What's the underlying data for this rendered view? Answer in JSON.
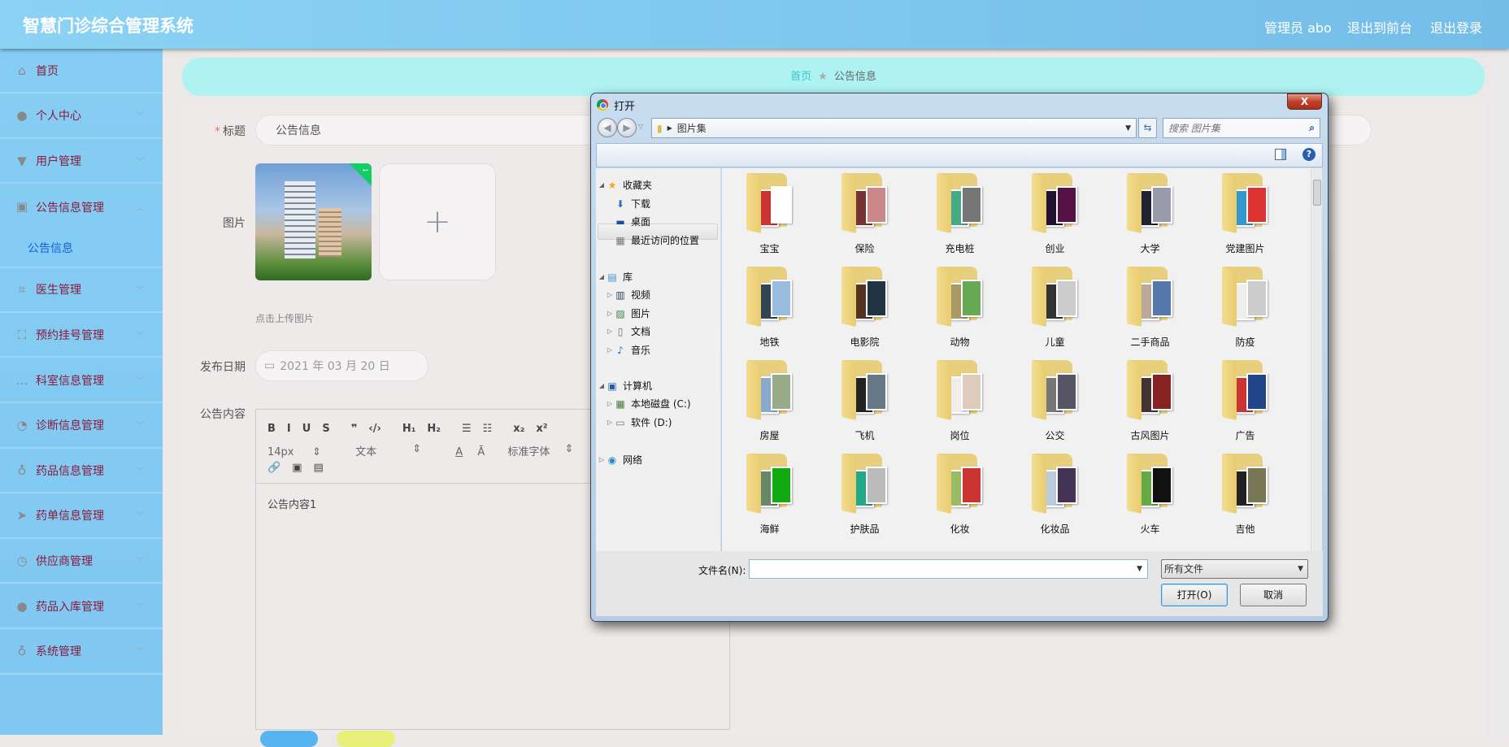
{
  "header": {
    "title": "智慧门诊综合管理系统",
    "user": "管理员 abo",
    "front": "退出到前台",
    "logout": "退出登录"
  },
  "sidebar": {
    "items": [
      {
        "label": "首页",
        "icon": "home-icon",
        "glyph": "⌂"
      },
      {
        "label": "个人中心",
        "icon": "user-icon",
        "glyph": "●"
      },
      {
        "label": "用户管理",
        "icon": "pin-icon",
        "glyph": "▼"
      },
      {
        "label": "公告信息管理",
        "icon": "clipboard-icon",
        "glyph": "▣",
        "expanded": true,
        "sub": "公告信息"
      },
      {
        "label": "医生管理",
        "icon": "crop-icon",
        "glyph": "⌗"
      },
      {
        "label": "预约挂号管理",
        "icon": "fullscreen-icon",
        "glyph": "⛶"
      },
      {
        "label": "科室信息管理",
        "icon": "chat-icon",
        "glyph": "…"
      },
      {
        "label": "诊断信息管理",
        "icon": "dashboard-icon",
        "glyph": "◔"
      },
      {
        "label": "药品信息管理",
        "icon": "microphone-icon",
        "glyph": "♁"
      },
      {
        "label": "药单信息管理",
        "icon": "send-icon",
        "glyph": "➤"
      },
      {
        "label": "供应商管理",
        "icon": "clock-icon",
        "glyph": "◷"
      },
      {
        "label": "药品入库管理",
        "icon": "user-icon",
        "glyph": "●"
      },
      {
        "label": "系统管理",
        "icon": "mic-icon",
        "glyph": "♁"
      }
    ]
  },
  "breadcrumb": {
    "home": "首页",
    "sep": "★",
    "current": "公告信息"
  },
  "form": {
    "title_label": "标题",
    "title_value": "公告信息",
    "image_label": "图片",
    "upload_tip": "点击上传图片",
    "date_label": "发布日期",
    "date_value": "2021 年 03 月 20 日",
    "content_label": "公告内容",
    "content_value": "公告内容1"
  },
  "editor": {
    "row1": [
      "B",
      "I",
      "U",
      "S",
      "❞",
      "‹/›",
      "H₁",
      "H₂",
      "☰",
      "☷",
      "x₂",
      "x²"
    ],
    "size": "14px",
    "type": "文本",
    "font": "标准字体",
    "row3": [
      "🔗",
      "▣",
      "▤"
    ]
  },
  "dialog": {
    "title": "打开",
    "close": "X",
    "path": "图片集",
    "search_placeholder": "搜索 图片集",
    "nav": [
      {
        "label": "收藏夹",
        "icon": "star-icon",
        "glyph": "★",
        "color": "#f2a516",
        "level": 0,
        "tri": "◢"
      },
      {
        "label": "下载",
        "icon": "download-icon",
        "glyph": "⬇",
        "color": "#2a6fc9",
        "level": 1
      },
      {
        "label": "桌面",
        "icon": "desktop-icon",
        "glyph": "▬",
        "color": "#1d4f9e",
        "level": 1
      },
      {
        "label": "最近访问的位置",
        "icon": "recent-icon",
        "glyph": "▦",
        "color": "#777",
        "level": 1
      },
      {
        "label": "库",
        "icon": "library-icon",
        "glyph": "▤",
        "color": "#3b8fd0",
        "level": 0,
        "tri": "◢"
      },
      {
        "label": "视频",
        "icon": "video-icon",
        "glyph": "▥",
        "color": "#345",
        "level": 1,
        "tri": "▷"
      },
      {
        "label": "图片",
        "icon": "picture-icon",
        "glyph": "▨",
        "color": "#3a7d4e",
        "level": 1,
        "tri": "▷"
      },
      {
        "label": "文档",
        "icon": "document-icon",
        "glyph": "▯",
        "color": "#667",
        "level": 1,
        "tri": "▷"
      },
      {
        "label": "音乐",
        "icon": "music-icon",
        "glyph": "♪",
        "color": "#1b6fd0",
        "level": 1,
        "tri": "▷"
      },
      {
        "label": "计算机",
        "icon": "computer-icon",
        "glyph": "▣",
        "color": "#1d5fae",
        "level": 0,
        "tri": "◢"
      },
      {
        "label": "本地磁盘 (C:)",
        "icon": "drive-c-icon",
        "glyph": "▦",
        "color": "#4a7a3a",
        "level": 1,
        "tri": "▷"
      },
      {
        "label": "软件 (D:)",
        "icon": "drive-d-icon",
        "glyph": "▭",
        "color": "#777",
        "level": 1,
        "tri": "▷"
      },
      {
        "label": "网络",
        "icon": "network-icon",
        "glyph": "◉",
        "color": "#2a88c9",
        "level": 0,
        "tri": "▷"
      }
    ],
    "folders": [
      "宝宝",
      "保险",
      "充电桩",
      "创业",
      "大学",
      "党建图片",
      "地铁",
      "电影院",
      "动物",
      "儿童",
      "二手商品",
      "防疫",
      "房屋",
      "飞机",
      "岗位",
      "公交",
      "古风图片",
      "广告",
      "海鲜",
      "护肤品",
      "化妆",
      "化妆品",
      "火车",
      "吉他"
    ],
    "filename_label": "文件名(N):",
    "filename_value": "",
    "filter": "所有文件",
    "open": "打开(O)",
    "cancel": "取消"
  }
}
